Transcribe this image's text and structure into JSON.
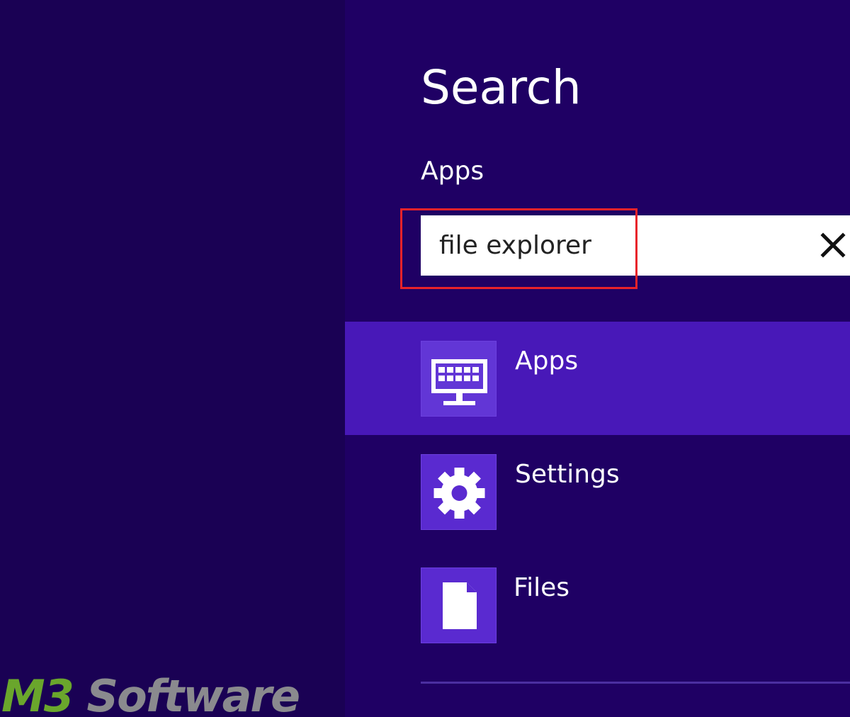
{
  "pane": {
    "title": "Search",
    "scope_label": "Apps"
  },
  "search": {
    "value": "file explorer",
    "placeholder": "",
    "clear_icon": "close-icon"
  },
  "results": [
    {
      "label": "Apps",
      "icon": "apps-monitor-icon",
      "selected": true
    },
    {
      "label": "Settings",
      "icon": "gear-icon",
      "selected": false
    },
    {
      "label": "Files",
      "icon": "file-icon",
      "selected": false
    }
  ],
  "annotation": {
    "color": "#e8222a"
  },
  "watermark": {
    "brand_part1": "M3",
    "brand_part2": " Software",
    "color1": "#6aa62c",
    "color2": "#8a8a8e"
  },
  "colors": {
    "background": "#1a0154",
    "pane": "#1f0064",
    "selected_row": "#4818b8",
    "tile": "#5a2ad0"
  }
}
